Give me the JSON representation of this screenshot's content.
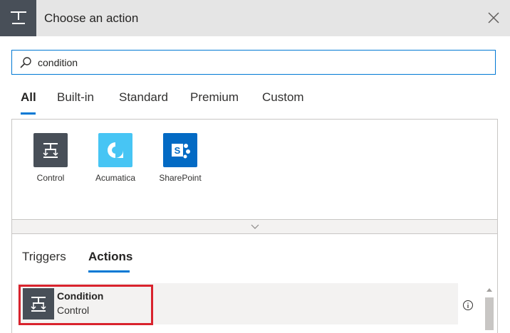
{
  "header": {
    "title": "Choose an action",
    "icon": "control-icon",
    "close_icon": "close-icon"
  },
  "search": {
    "value": "condition",
    "placeholder": "",
    "icon": "search-icon"
  },
  "tabs": [
    {
      "label": "All",
      "active": true
    },
    {
      "label": "Built-in",
      "active": false
    },
    {
      "label": "Standard",
      "active": false
    },
    {
      "label": "Premium",
      "active": false
    },
    {
      "label": "Custom",
      "active": false
    }
  ],
  "connectors": [
    {
      "label": "Control",
      "color": "#484f58",
      "icon": "control-icon"
    },
    {
      "label": "Acumatica",
      "color": "#47c5f4",
      "icon": "acumatica-icon"
    },
    {
      "label": "SharePoint",
      "color": "#036ac4",
      "icon": "sharepoint-icon"
    }
  ],
  "subtabs": [
    {
      "label": "Triggers",
      "active": false
    },
    {
      "label": "Actions",
      "active": true
    }
  ],
  "actions": [
    {
      "title": "Condition",
      "subtitle": "Control",
      "icon": "control-icon"
    }
  ],
  "colors": {
    "accent": "#0078d4",
    "highlight": "#d9232d"
  }
}
